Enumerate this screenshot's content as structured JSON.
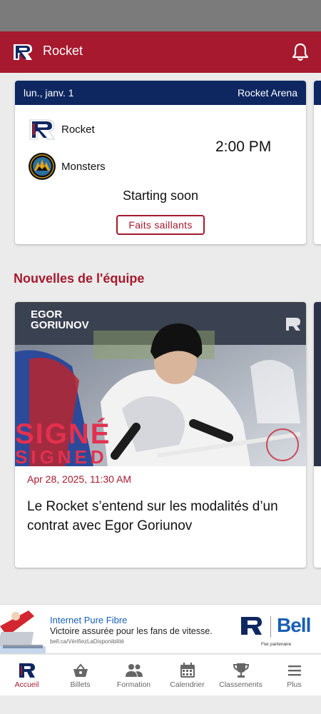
{
  "app": {
    "title": "Rocket",
    "accent": "#a6192e",
    "navy": "#0e2761"
  },
  "game": {
    "date": "lun., janv. 1",
    "venue": "Rocket Arena",
    "home_team": "Rocket",
    "away_team": "Monsters",
    "time": "2:00 PM",
    "status": "Starting soon",
    "highlights_label": "Faits saillants"
  },
  "news": {
    "section_title": "Nouvelles de l'équipe",
    "articles": [
      {
        "image_player_name": "EGOR GORIUNOV",
        "image_text_fr": "SIGNÉ",
        "image_text_en": "SIGNED",
        "date": "Apr 28, 2025, 11:30 AM",
        "headline": "Le Rocket s’entend sur les modalités d’un contrat avec Egor Goriunov"
      }
    ]
  },
  "ad": {
    "headline": "Internet Pure Fibre",
    "text": "Victoire assurée pour les fans de vitesse.",
    "url": "bell.ca/VérifiezLaDisponibilité",
    "brand": "Bell",
    "partner": "Fier partenaire"
  },
  "nav": {
    "items": [
      {
        "label": "Accueil",
        "icon": "rocket-logo-icon"
      },
      {
        "label": "Billets",
        "icon": "basket-icon"
      },
      {
        "label": "Formation",
        "icon": "people-icon"
      },
      {
        "label": "Calendrier",
        "icon": "calendar-icon"
      },
      {
        "label": "Classements",
        "icon": "trophy-icon"
      },
      {
        "label": "Plus",
        "icon": "menu-icon"
      }
    ]
  }
}
